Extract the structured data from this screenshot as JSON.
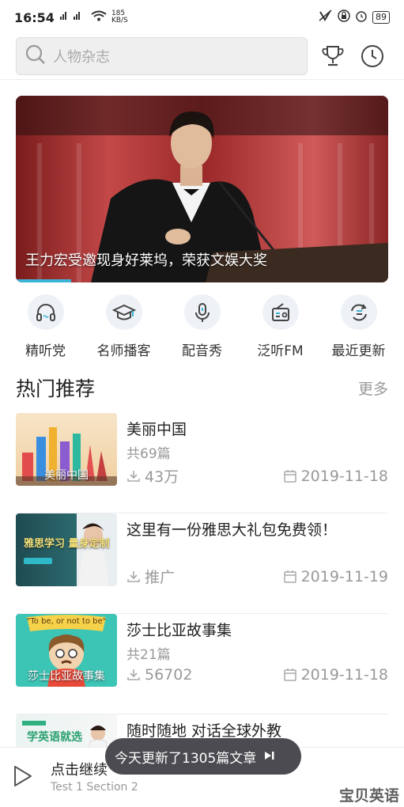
{
  "status_bar": {
    "time": "16:54",
    "network_speed": "185",
    "network_unit": "KB/S",
    "battery": "89"
  },
  "search": {
    "placeholder": "人物杂志"
  },
  "banner": {
    "caption": "王力宏受邀现身好莱坞，荣获文娱大奖",
    "accent": "#3ab5d6"
  },
  "quick_nav": [
    {
      "label": "精听党",
      "icon": "headphones-icon"
    },
    {
      "label": "名师播客",
      "icon": "graduation-cap-icon"
    },
    {
      "label": "配音秀",
      "icon": "microphone-icon"
    },
    {
      "label": "泛听FM",
      "icon": "radio-icon"
    },
    {
      "label": "最近更新",
      "icon": "refresh-list-icon"
    }
  ],
  "section": {
    "title": "热门推荐",
    "more": "更多"
  },
  "articles": [
    {
      "title": "美丽中国",
      "sub": "共69篇",
      "downloads": "43万",
      "date": "2019-11-18",
      "thumb_label": "美丽中国"
    },
    {
      "title": "这里有一份雅思大礼包免费领！",
      "sub": "",
      "downloads": "推广",
      "date": "2019-11-19",
      "thumb_label": "雅思学习 量身定制"
    },
    {
      "title": "莎士比亚故事集",
      "sub": "共21篇",
      "downloads": "56702",
      "date": "2019-11-18",
      "thumb_label": "莎士比亚故事集",
      "thumb_caption": "\"To be, or not to be\""
    },
    {
      "title": "随时随地 对话全球外教",
      "sub": "",
      "downloads": "",
      "date": "",
      "thumb_label": "学英语就选"
    }
  ],
  "toast": {
    "text": "今天更新了1305篇文章"
  },
  "player": {
    "title": "点击继续",
    "sub": "Test 1 Section 2"
  },
  "watermark": {
    "text": "宝贝英语"
  }
}
